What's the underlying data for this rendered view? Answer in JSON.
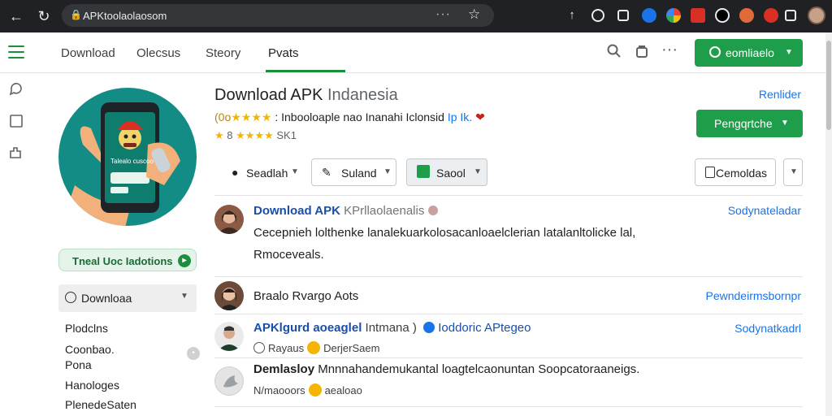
{
  "browser": {
    "url": "APKtoolaolaosom",
    "more_glyph": "···",
    "back_glyph": "←",
    "reload_glyph": "↻",
    "star_glyph": "☆",
    "lock_glyph": "🔒"
  },
  "header": {
    "tabs": [
      {
        "label": "Download"
      },
      {
        "label": "Olecsus"
      },
      {
        "label": "Steory"
      },
      {
        "label": "Pvats"
      }
    ],
    "active_tab": "Pvats",
    "action_button": "eomliaelo",
    "icons": [
      "search-icon",
      "bag-icon",
      "more-icon"
    ]
  },
  "rail": {
    "icons": [
      "hamburger-icon",
      "chat-icon",
      "square-icon",
      "puzzle-icon"
    ]
  },
  "left_panel": {
    "app_icon_text": "Talealo cuscoo",
    "pill_label": "Tneal Uoc Iadotions",
    "dropdown_label": "Downloaa",
    "items": [
      "Plodclns",
      "Coonbao.",
      "Pona",
      "Hanologes",
      "PlenedeSaten"
    ]
  },
  "main": {
    "title_strong": "Download APK",
    "title_rest": " Indanesia",
    "right_link": "Renlider",
    "rating_prefix": "(0o",
    "rating_text": " : Inbooloaple nao Inanahi Iclonsid",
    "rating_link": "Ip Ik.",
    "rating2_text": "SK1",
    "install_button": "Pengqrtche",
    "toolbar": {
      "b1": "Seadlah",
      "b2": "Suland",
      "b3": "Saool",
      "b4": "Cemoldas"
    },
    "rows": [
      {
        "title": "Download APK",
        "title_muted": " KPrllaolaenalis",
        "right": "Sodynateladar",
        "body1": "Cecepnieh lolthenke lanalekuarkolosacanloaelclerian latalanltolicke lal,",
        "body2": "Rmoceveals."
      },
      {
        "title": "Braalo Rvargo Aots",
        "right": "Pewndeirmsbornpr"
      },
      {
        "title": "APKlgurd aoeaglel",
        "title_muted": " Intmana )",
        "title_link": "Ioddoric APtegeo",
        "right": "Sodynatkadrl",
        "sub": "Rayaus",
        "sub2": "DerjerSaem"
      },
      {
        "title": "Demlasloy",
        "title_rest": " Mnnnahandemukantal loagtelcaonuntan Soopcatoraaneigs.",
        "sub": "N/maooors",
        "sub2": "aealoao"
      }
    ]
  },
  "colors": {
    "accent_green": "#1e9e4a",
    "link_blue": "#1a73e8",
    "star_yellow": "#f4b400",
    "teal": "#138c86"
  }
}
